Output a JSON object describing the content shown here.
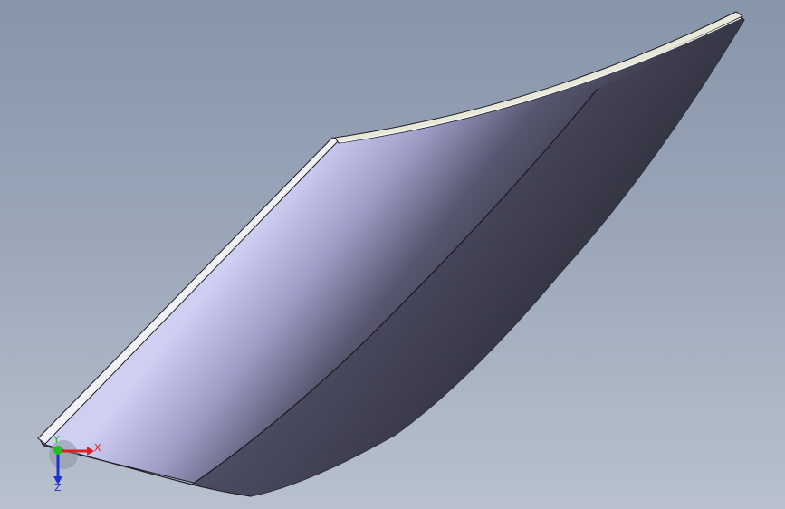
{
  "viewport": {
    "background_top": "#8795aa",
    "background_bottom": "#b8c1cd"
  },
  "model": {
    "face_light": "#c9c9ef",
    "face_mid": "#6d6d8c",
    "face_dark": "#2f3039",
    "edge_color": "#1e1e24",
    "rim_highlight": "#f4f4f8"
  },
  "triad": {
    "x_label": "X",
    "y_label": "Y",
    "z_label": "Z",
    "x_color": "#e02020",
    "y_color": "#20c020",
    "z_color": "#2030d0"
  }
}
